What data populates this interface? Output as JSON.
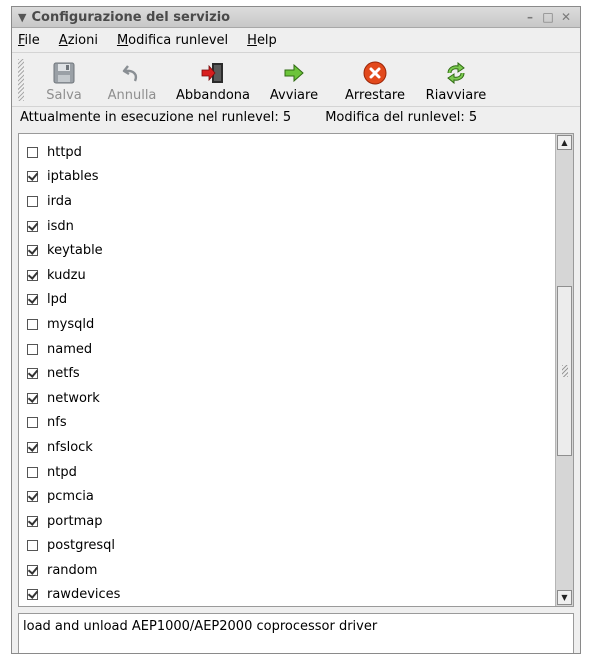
{
  "window": {
    "title": "Configurazione del servizio",
    "controls": {
      "minimize": "–",
      "maximize": "□",
      "close": "✕"
    }
  },
  "menubar": {
    "items": [
      {
        "mnemonic": "F",
        "rest": "ile"
      },
      {
        "mnemonic": "A",
        "rest": "zioni"
      },
      {
        "mnemonic": "M",
        "rest": "odifica runlevel"
      },
      {
        "mnemonic": "H",
        "rest": "elp"
      }
    ]
  },
  "toolbar": {
    "save": {
      "label": "Salva",
      "icon": "floppy-disk-icon",
      "enabled": false
    },
    "undo": {
      "label": "Annulla",
      "icon": "undo-arrow-icon",
      "enabled": false
    },
    "quit": {
      "label": "Abbandona",
      "icon": "exit-door-icon",
      "enabled": true
    },
    "start": {
      "label": "Avviare",
      "icon": "green-arrow-icon",
      "enabled": true
    },
    "stop": {
      "label": "Arrestare",
      "icon": "red-stop-icon",
      "enabled": true
    },
    "restart": {
      "label": "Riavviare",
      "icon": "green-refresh-icon",
      "enabled": true
    }
  },
  "status": {
    "current_runlevel": "Attualmente in esecuzione nel runlevel: 5",
    "edit_runlevel": "Modifica del runlevel: 5"
  },
  "services": [
    {
      "name": "httpd",
      "checked": false
    },
    {
      "name": "iptables",
      "checked": true
    },
    {
      "name": "irda",
      "checked": false
    },
    {
      "name": "isdn",
      "checked": true
    },
    {
      "name": "keytable",
      "checked": true
    },
    {
      "name": "kudzu",
      "checked": true
    },
    {
      "name": "lpd",
      "checked": true
    },
    {
      "name": "mysqld",
      "checked": false
    },
    {
      "name": "named",
      "checked": false
    },
    {
      "name": "netfs",
      "checked": true
    },
    {
      "name": "network",
      "checked": true
    },
    {
      "name": "nfs",
      "checked": false
    },
    {
      "name": "nfslock",
      "checked": true
    },
    {
      "name": "ntpd",
      "checked": false
    },
    {
      "name": "pcmcia",
      "checked": true
    },
    {
      "name": "portmap",
      "checked": true
    },
    {
      "name": "postgresql",
      "checked": false
    },
    {
      "name": "random",
      "checked": true
    },
    {
      "name": "rawdevices",
      "checked": true
    }
  ],
  "description": "load and unload AEP1000/AEP2000 coprocessor driver"
}
